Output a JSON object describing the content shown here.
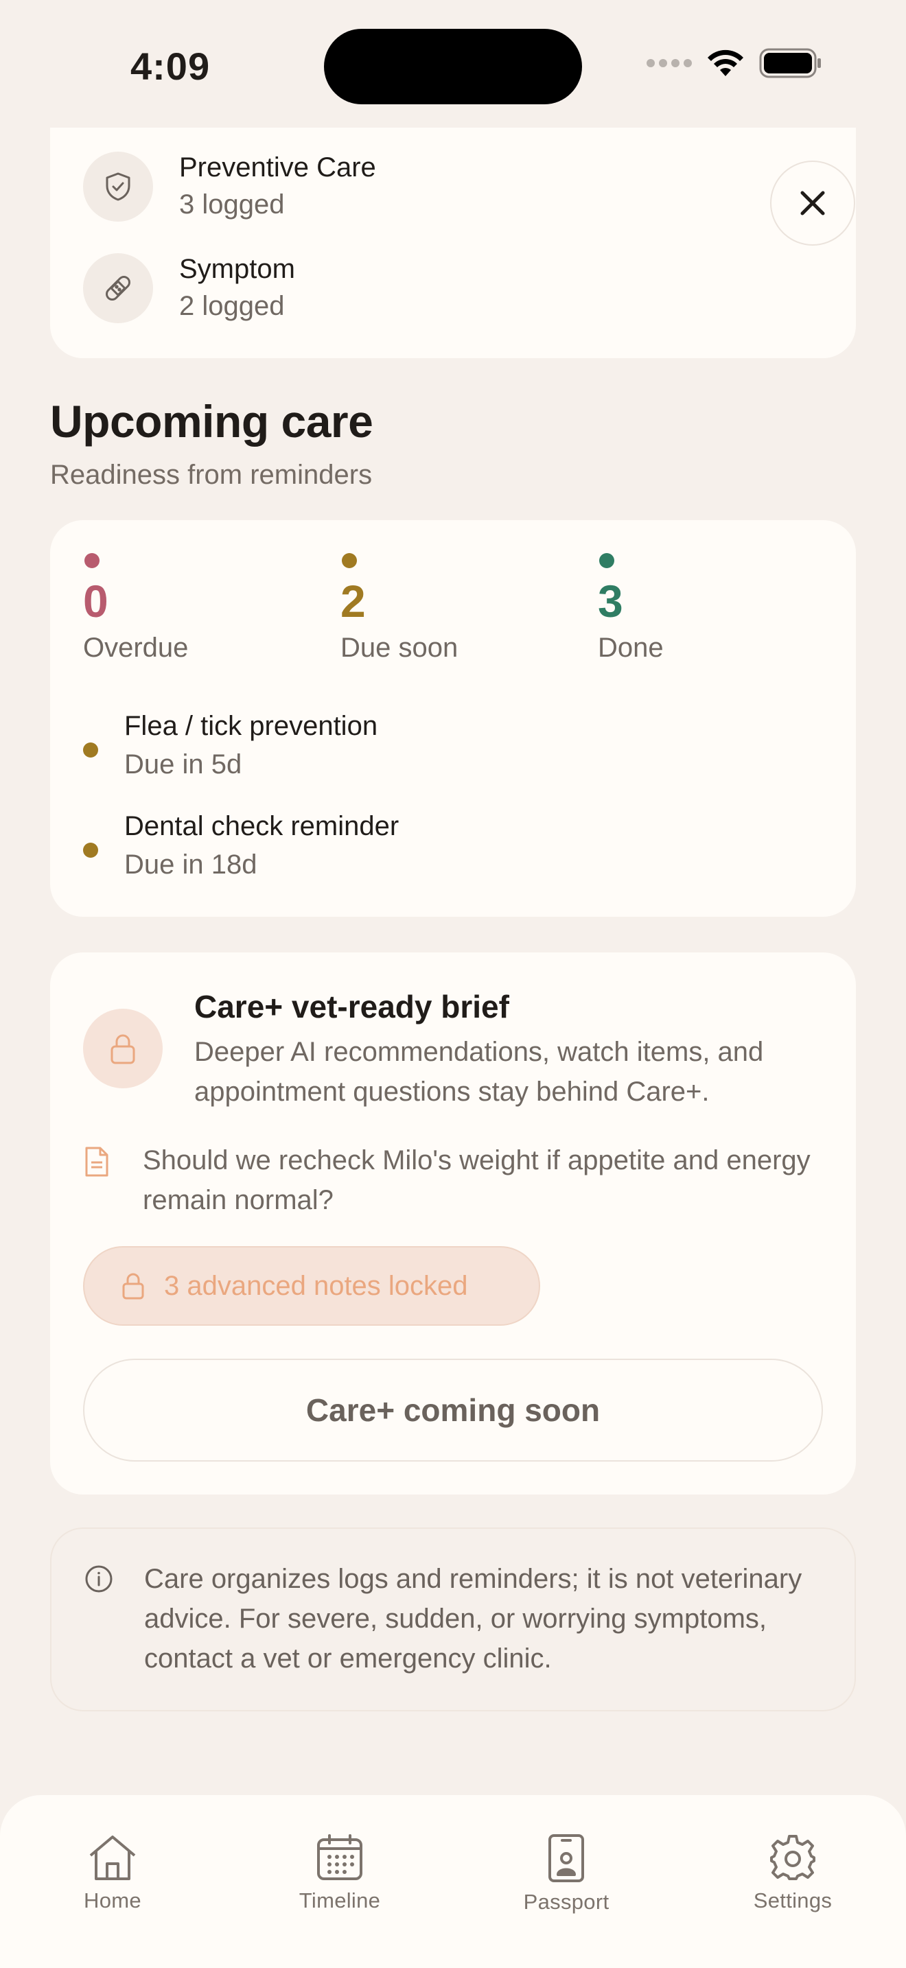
{
  "status_bar": {
    "time": "4:09"
  },
  "log_summary": {
    "items": [
      {
        "title": "Preventive Care",
        "count": "3 logged",
        "icon": "shield-check-icon"
      },
      {
        "title": "Symptom",
        "count": "2 logged",
        "icon": "bandage-icon"
      }
    ],
    "close_icon": "close-icon"
  },
  "upcoming": {
    "title": "Upcoming care",
    "subtitle": "Readiness from reminders",
    "stats": [
      {
        "value": "0",
        "label": "Overdue",
        "color": "#b85b6e"
      },
      {
        "value": "2",
        "label": "Due soon",
        "color": "#a07a22"
      },
      {
        "value": "3",
        "label": "Done",
        "color": "#2f7d63"
      }
    ],
    "due_items": [
      {
        "title": "Flea / tick prevention",
        "due": "Due in 5d"
      },
      {
        "title": "Dental check reminder",
        "due": "Due in 18d"
      }
    ]
  },
  "careplus": {
    "title": "Care+ vet-ready brief",
    "description": "Deeper AI recommendations, watch items, and appointment questions stay behind Care+.",
    "question": "Should we recheck Milo's weight if appetite and energy remain normal?",
    "locked_label": "3 advanced notes locked",
    "button_label": "Care+ coming soon",
    "accent": "#eaa77f"
  },
  "disclaimer": {
    "text": "Care organizes logs and reminders; it is not veterinary advice. For severe, sudden, or worrying symptoms, contact a vet or emergency clinic."
  },
  "tabbar": {
    "tabs": [
      {
        "label": "Home",
        "icon": "home-icon"
      },
      {
        "label": "Timeline",
        "icon": "calendar-icon"
      },
      {
        "label": "Passport",
        "icon": "passport-icon"
      },
      {
        "label": "Settings",
        "icon": "gear-icon"
      }
    ]
  }
}
